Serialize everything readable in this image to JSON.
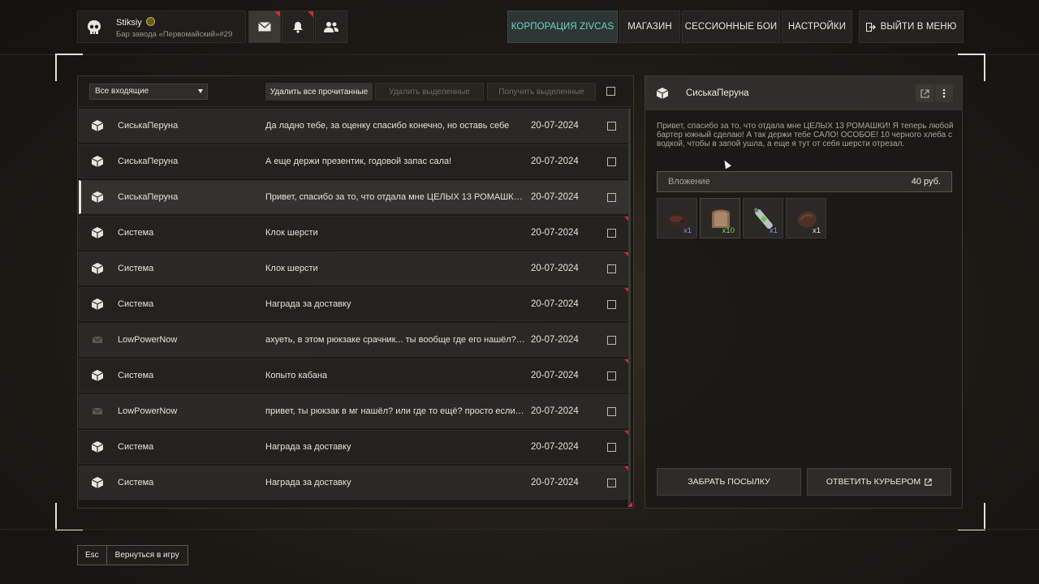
{
  "player": {
    "name": "Stiksiy",
    "location": "Бар завода «Первомайский»#29"
  },
  "top_icons": [
    {
      "name": "mail",
      "flag": true
    },
    {
      "name": "bell",
      "flag": true
    },
    {
      "name": "friends",
      "flag": false
    }
  ],
  "nav": {
    "corporation": "КОРПОРАЦИЯ ZIVCAS",
    "shop": "МАГАЗИН",
    "session_fights": "СЕССИОННЫЕ БОИ",
    "settings": "НАСТРОЙКИ",
    "exit": "ВЫЙТИ В МЕНЮ"
  },
  "mail": {
    "filter": "Все входящие",
    "delete_read": "Удалить все прочитанные",
    "delete_selected": "Удалить выделенные",
    "get_selected": "Получить выделенные",
    "messages": [
      {
        "icon": "package",
        "sender": "СиськаПеруна",
        "subject": "Да ладно тебе, за оценку спасибо конечно, но оставь себе",
        "date": "20-07-2024",
        "unread": false,
        "selected": false
      },
      {
        "icon": "package",
        "sender": "СиськаПеруна",
        "subject": "А еще держи презентик, годовой запас сала!",
        "date": "20-07-2024",
        "unread": false,
        "selected": false
      },
      {
        "icon": "package",
        "sender": "СиськаПеруна",
        "subject": "Привет, спасибо за то, что отдала мне ЦЕЛЫХ 13 РОМАШКИ...",
        "date": "20-07-2024",
        "unread": false,
        "selected": true
      },
      {
        "icon": "package",
        "sender": "Система",
        "subject": "Клок шерсти",
        "date": "20-07-2024",
        "unread": true,
        "selected": false
      },
      {
        "icon": "package",
        "sender": "Система",
        "subject": "Клок шерсти",
        "date": "20-07-2024",
        "unread": true,
        "selected": false
      },
      {
        "icon": "package",
        "sender": "Система",
        "subject": "Награда за доставку",
        "date": "20-07-2024",
        "unread": true,
        "selected": false
      },
      {
        "icon": "envelope",
        "sender": "LowPowerNow",
        "subject": "ахуеть, в этом рюкзаке срачник... ты вообще где его нашёл? н...",
        "date": "20-07-2024",
        "unread": false,
        "selected": false
      },
      {
        "icon": "package",
        "sender": "Система",
        "subject": "Копыто кабана",
        "date": "20-07-2024",
        "unread": true,
        "selected": false
      },
      {
        "icon": "envelope",
        "sender": "LowPowerNow",
        "subject": "привет, ты рюкзак в мг нашёл? или где то ещё? просто если в...",
        "date": "20-07-2024",
        "unread": false,
        "selected": false
      },
      {
        "icon": "package",
        "sender": "Система",
        "subject": "Награда за доставку",
        "date": "20-07-2024",
        "unread": true,
        "selected": false
      },
      {
        "icon": "package",
        "sender": "Система",
        "subject": "Награда за доставку",
        "date": "20-07-2024",
        "unread": true,
        "selected": false
      }
    ]
  },
  "detail": {
    "sender": "СиськаПеруна",
    "body": "Привет, спасибо за то, что отдала мне ЦЕЛЫХ 13 РОМАШКИ! Я теперь любой бартер южный сделаю! А так держи тебе САЛО! ОСОБОЕ! 10 черного хлеба с водкой, чтобы в запой ушла, а еще я тут от себя шерсти отрезал.",
    "attachment_label": "Вложение",
    "attachment_amount": "40 руб.",
    "items": [
      {
        "icon": "meat-icon",
        "count": "x1",
        "count_color": "#8a8cf0"
      },
      {
        "icon": "bread-icon",
        "count": "x10",
        "count_color": "#7fd35e"
      },
      {
        "icon": "bottle-icon",
        "count": "x1",
        "count_color": "#8a8cf0"
      },
      {
        "icon": "wool-icon",
        "count": "x1",
        "count_color": "#e8e5de"
      }
    ],
    "take_button": "ЗАБРАТЬ ПОСЫЛКУ",
    "reply_button": "ОТВЕТИТЬ КУРЬЕРОМ"
  },
  "footer": {
    "key": "Esc",
    "label": "Вернуться в игру"
  },
  "colors": {
    "accent_teal": "#6fd3c6",
    "unread_flag": "#d02a3a"
  }
}
